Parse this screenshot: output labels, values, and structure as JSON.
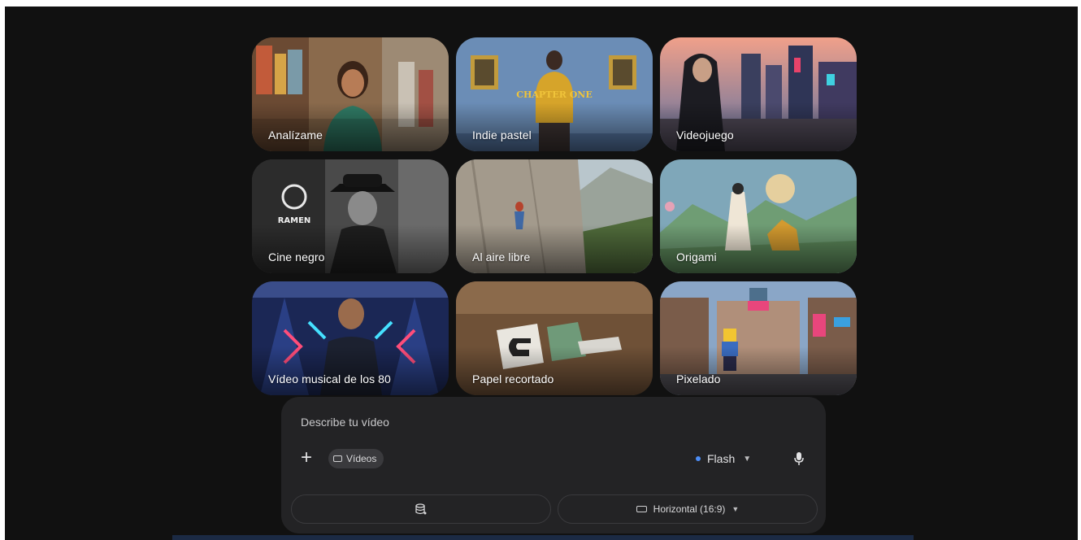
{
  "styles": [
    {
      "label": "Analízame",
      "scene": "market"
    },
    {
      "label": "Indie pastel",
      "scene": "gallery"
    },
    {
      "label": "Videojuego",
      "scene": "game"
    },
    {
      "label": "Cine negro",
      "scene": "noir"
    },
    {
      "label": "Al aire libre",
      "scene": "outdoor"
    },
    {
      "label": "Origami",
      "scene": "origami"
    },
    {
      "label": "Vídeo musical de los 80",
      "scene": "stage"
    },
    {
      "label": "Papel recortado",
      "scene": "papercut"
    },
    {
      "label": "Pixelado",
      "scene": "pixel"
    }
  ],
  "scene_text": {
    "chapter_sign": "CHAPTER ONE",
    "ramen_sign": "RAMEN"
  },
  "composer": {
    "placeholder": "Describe tu vídeo",
    "chip_label": "Vídeos",
    "model_label": "Flash",
    "aspect_label": "Horizontal (16:9)"
  },
  "icons": {
    "add": "plus-icon",
    "chip": "video-icon",
    "model_status": "dot-icon",
    "dropdown": "chevron-down-icon",
    "voice": "microphone-icon",
    "storage": "database-icon",
    "aspect": "rectangle-icon"
  },
  "colors": {
    "background": "#111111",
    "panel": "#232325",
    "model_dot": "#4c8df6"
  }
}
